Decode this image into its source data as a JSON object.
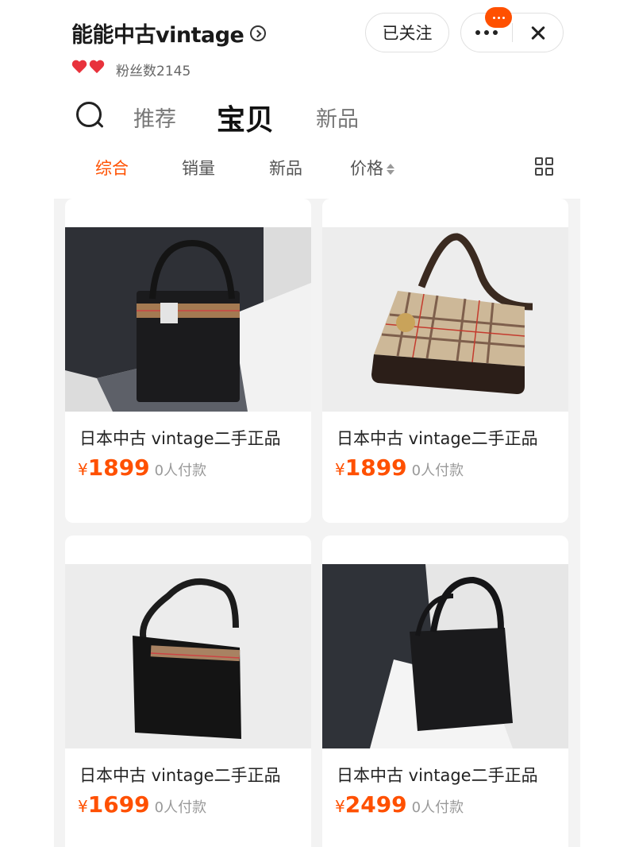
{
  "shop": {
    "name": "能能中古vintage",
    "fans": "粉丝数2145",
    "follow_label": "已关注"
  },
  "tabs": [
    {
      "label": "推荐",
      "active": false
    },
    {
      "label": "宝贝",
      "active": true
    },
    {
      "label": "新品",
      "active": false
    }
  ],
  "sort": [
    {
      "label": "综合",
      "active": true
    },
    {
      "label": "销量",
      "active": false
    },
    {
      "label": "新品",
      "active": false
    },
    {
      "label": "价格",
      "active": false
    }
  ],
  "products": [
    {
      "title": "日本中古 vintage二手正品",
      "currency": "¥",
      "price": "1899",
      "paid": "0人付款",
      "image": "black-tote-in-box-icon"
    },
    {
      "title": "日本中古 vintage二手正品",
      "currency": "¥",
      "price": "1899",
      "paid": "0人付款",
      "image": "plaid-shoulder-bag-icon"
    },
    {
      "title": "日本中古 vintage二手正品",
      "currency": "¥",
      "price": "1699",
      "paid": "0人付款",
      "image": "black-flap-bag-icon"
    },
    {
      "title": "日本中古 vintage二手正品",
      "currency": "¥",
      "price": "2499",
      "paid": "0人付款",
      "image": "black-tote-with-dustbag-icon"
    }
  ],
  "colors": {
    "accent": "#ff5000",
    "heart": "#e8323c",
    "background": "#f3f3f3"
  },
  "icons": [
    "search-icon",
    "chevron-right-icon",
    "more-dots-icon",
    "close-icon",
    "grid-view-icon",
    "heart-icon",
    "sort-arrows-icon"
  ]
}
